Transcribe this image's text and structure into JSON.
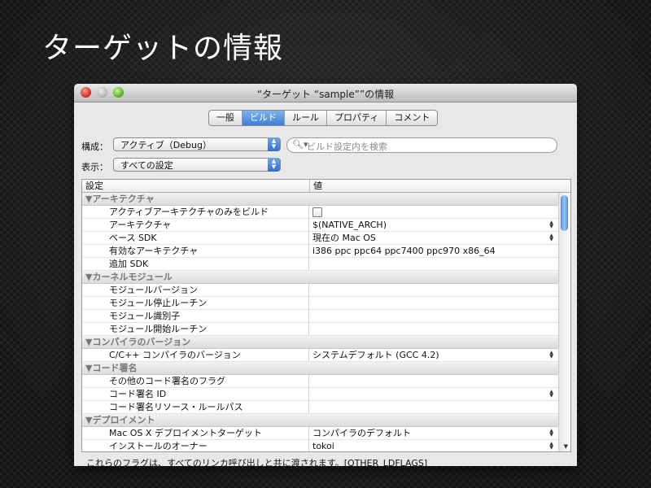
{
  "slide": {
    "title": "ターゲットの情報"
  },
  "window": {
    "title": "“ターゲット “sample””の情報"
  },
  "tabs": [
    "一般",
    "ビルド",
    "ルール",
    "プロパティ",
    "コメント"
  ],
  "config": {
    "label": "構成：",
    "value": "アクティブ（Debug）"
  },
  "show": {
    "label": "表示：",
    "value": "すべての設定"
  },
  "search": {
    "placeholder": "ビルド設定内を検索"
  },
  "table": {
    "headers": {
      "setting": "設定",
      "value": "値"
    },
    "rows": [
      {
        "kind": "group",
        "label": "▼アーキテクチャ"
      },
      {
        "kind": "item",
        "setting": "アクティブアーキテクチャのみをビルド",
        "value": "",
        "checkbox": true
      },
      {
        "kind": "item",
        "setting": "アーキテクチャ",
        "value": "$(NATIVE_ARCH)",
        "stepper": true
      },
      {
        "kind": "item",
        "setting": "ベース SDK",
        "value": "現在の Mac OS",
        "stepper": true
      },
      {
        "kind": "item",
        "setting": "有効なアーキテクチャ",
        "value": "i386 ppc ppc64 ppc7400 ppc970 x86_64"
      },
      {
        "kind": "item",
        "setting": "追加 SDK",
        "value": ""
      },
      {
        "kind": "group",
        "label": "▼カーネルモジュール"
      },
      {
        "kind": "item",
        "setting": "モジュールバージョン",
        "value": ""
      },
      {
        "kind": "item",
        "setting": "モジュール停止ルーチン",
        "value": ""
      },
      {
        "kind": "item",
        "setting": "モジュール識別子",
        "value": ""
      },
      {
        "kind": "item",
        "setting": "モジュール開始ルーチン",
        "value": ""
      },
      {
        "kind": "group",
        "label": "▼コンパイラのバージョン"
      },
      {
        "kind": "item",
        "setting": "C/C++ コンパイラのバージョン",
        "value": "システムデフォルト (GCC 4.2)",
        "stepper": true
      },
      {
        "kind": "group",
        "label": "▼コード署名"
      },
      {
        "kind": "item",
        "setting": "その他のコード署名のフラグ",
        "value": ""
      },
      {
        "kind": "item",
        "setting": "コード署名 ID",
        "value": "",
        "stepper": true
      },
      {
        "kind": "item",
        "setting": "コード署名リソース・ルールパス",
        "value": ""
      },
      {
        "kind": "group",
        "label": "▼デプロイメント"
      },
      {
        "kind": "item",
        "setting": "Mac OS X デプロイメントターゲット",
        "value": "コンパイラのデフォルト",
        "stepper": true
      },
      {
        "kind": "item",
        "setting": "インストールのオーナー",
        "value": "tokoi",
        "stepper": true
      }
    ]
  },
  "description": "これらのフラグは、すべてのリンカ呼び出しと共に渡されます。[OTHER_LDFLAGS]"
}
